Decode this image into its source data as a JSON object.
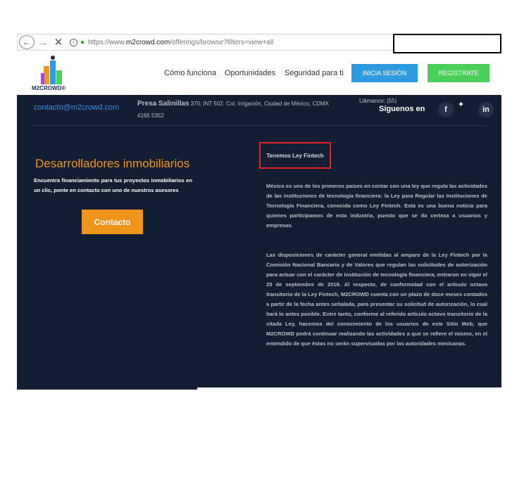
{
  "browser": {
    "back": "←",
    "forward": "→",
    "stop": "✕",
    "info": "i",
    "lock": "🔒",
    "url_prefix": "https://www.",
    "url_host": "m2crowd.com",
    "url_path": "/offerings/browse?filters=view+all"
  },
  "header": {
    "logo_text": "M2CROWD®",
    "nav": [
      "Cómo funciona",
      "Oportunidades",
      "Seguridad para ti"
    ],
    "login": "INICIA SESIÓN",
    "register": "REGÍSTRATE",
    "colors": {
      "login": "#2e9be0",
      "register": "#4ccf5a"
    }
  },
  "contact_bar": {
    "email": "contacto@m2crowd.com",
    "address_bold": "Presa Salinillas",
    "address_rest": " 370, INT 502. Col. Irrigación, Ciudad de México, CDMX",
    "address_line2": "4165 5352",
    "phone": "Llámanos: (55)",
    "follow": "Síguenos en",
    "social": [
      "f",
      "in"
    ],
    "twitter": "🐦"
  },
  "left": {
    "title": "Desarrolladores inmobiliarios",
    "description": "Encuentra financiamiento para tus proyectos inmobiliarios en un clic, ponte en contacto con uno de nuestros asesores",
    "button": "Contacto",
    "accent": "#f0951c"
  },
  "right": {
    "heading": "Tenemos Ley Fintech",
    "paragraph1": "México es uno de los primeros países en contar con una ley que regula las actividades de las instituciones de tecnología financiera: la Ley para Regular las Instituciones de Tecnología Financiera, conocida como Ley Fintech. Esta es una buena noticia para quienes participamos de esta industria, puesto que se da certeza a usuarios y empresas.",
    "paragraph2": "Las disposiciones de carácter general emitidas al amparo de la Ley Fintech por la Comisión Nacional Bancaria y de Valores que regulan las solicitudes de autorización para actuar con el carácter de institución de tecnología financiera, entraron en vigor el 25 de septiembre de 2018. Al respecto, de conformidad con el artículo octavo transitorio de la Ley Fintech, M2CROWD cuenta con un plazo de doce meses contados a partir de la fecha antes señalada, para presentar su solicitud de autorización, lo cual hará lo antes posible. Entre tanto, conforme al referido artículo octavo transitorio de la citada Ley, hacemos del conocimiento de los usuarios de este Sitio Web, que M2CROWD podrá continuar realizando las actividades a que se refiere el mismo, en el entendido de que éstas no serán supervisadas por las autoridades mexicanas."
  }
}
